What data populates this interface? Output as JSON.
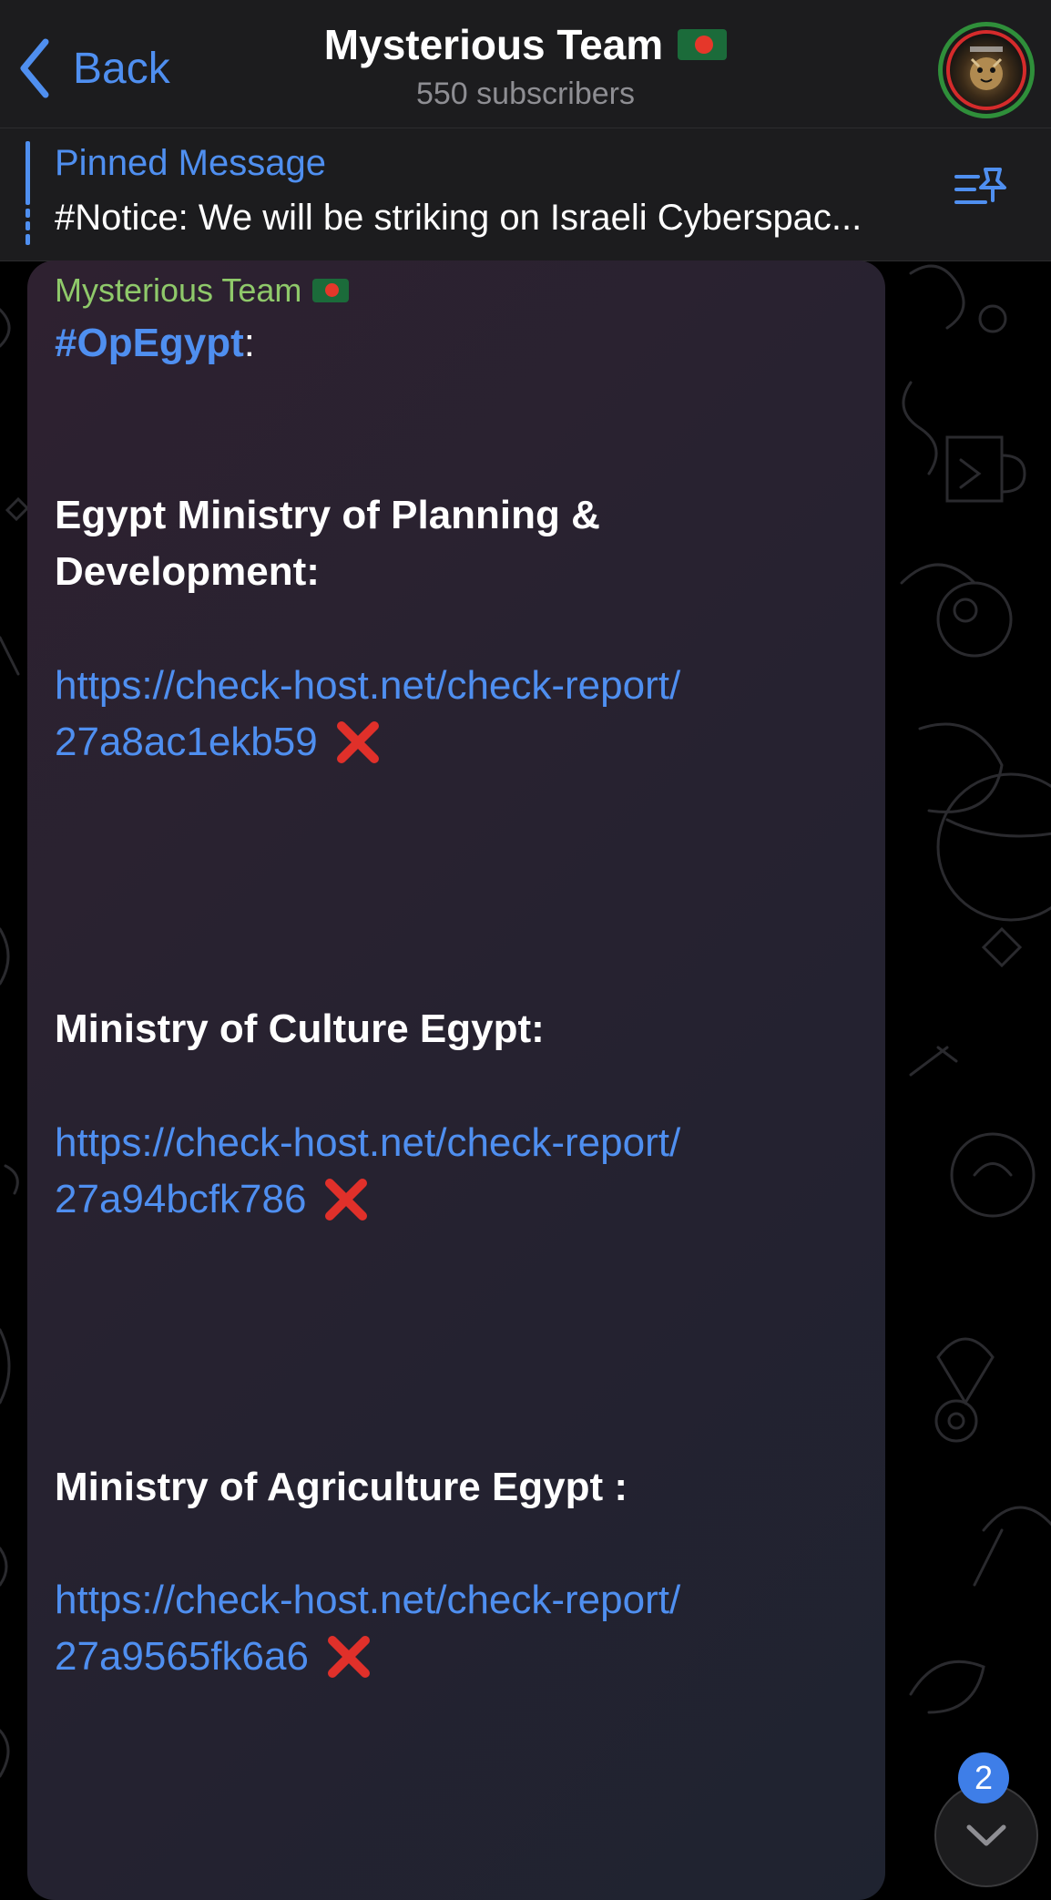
{
  "header": {
    "back_label": "Back",
    "title": "Mysterious Team",
    "subtitle": "550 subscribers"
  },
  "pinned": {
    "title": "Pinned Message",
    "text": "#Notice: We will be striking on Israeli Cyberspac..."
  },
  "message": {
    "sender": "Mysterious Team",
    "hashtag": "#OpEgypt",
    "hashtag_suffix": ":",
    "items": [
      {
        "title": "Egypt Ministry of Planning & Development:",
        "link_line1": "https://check-host.net/check-report/",
        "link_line2": "27a8ac1ekb59"
      },
      {
        "title": "Ministry of Culture Egypt:",
        "link_line1": "https://check-host.net/check-report/",
        "link_line2": "27a94bcfk786"
      },
      {
        "title": "Ministry of Agriculture Egypt :",
        "link_line1": "https://check-host.net/check-report/",
        "link_line2": "27a9565fk6a6"
      }
    ]
  },
  "scroll": {
    "unread_count": "2"
  },
  "colors": {
    "accent": "#4f8ff0",
    "sender": "#8fc96a",
    "cross": "#e0302a",
    "flag_green": "#1b6b3a",
    "flag_red": "#e5372a"
  },
  "icons": {
    "back": "chevron-left-icon",
    "pinned_list": "pinned-list-icon",
    "status": "cross-mark-icon",
    "scroll": "chevron-down-icon"
  }
}
